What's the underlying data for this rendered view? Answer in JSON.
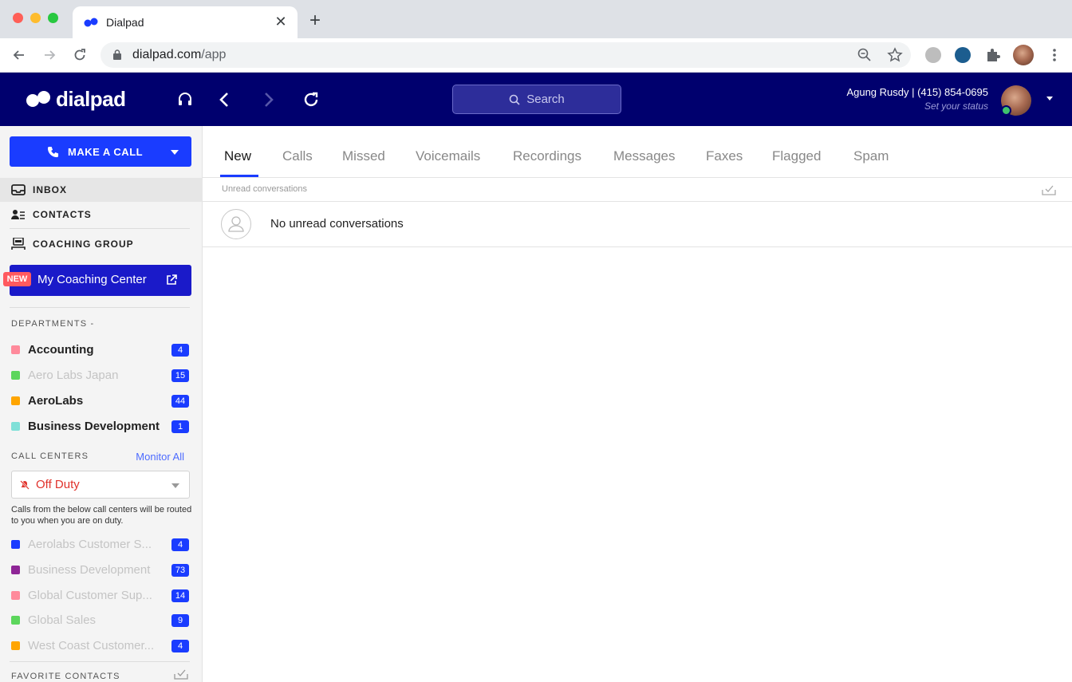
{
  "browser": {
    "tab_title": "Dialpad",
    "tab_close": "✕",
    "new_tab": "+",
    "url_host": "dialpad.com",
    "url_path": "/app"
  },
  "app": {
    "logo_text": "dialpad",
    "search_placeholder": "Search",
    "user_name": "Agung Rusdy | (415) 854-0695",
    "user_status": "Set your status"
  },
  "sidebar": {
    "make_call": "MAKE A CALL",
    "nav": [
      {
        "label": "INBOX",
        "icon": "inbox-icon"
      },
      {
        "label": "CONTACTS",
        "icon": "contacts-icon"
      },
      {
        "label": "COACHING GROUP",
        "icon": "coaching-group-icon"
      }
    ],
    "coaching_badge": "NEW",
    "coaching_center": "My Coaching Center",
    "departments_title": "DEPARTMENTS  -",
    "departments": [
      {
        "name": "Accounting",
        "count": "4",
        "color": "#ff8a9b",
        "dim": false
      },
      {
        "name": "Aero Labs Japan",
        "count": "15",
        "color": "#5cd65c",
        "dim": true
      },
      {
        "name": "AeroLabs",
        "count": "44",
        "color": "#ffa500",
        "dim": false
      },
      {
        "name": "Business Development",
        "count": "1",
        "color": "#7fe0d8",
        "dim": false
      }
    ],
    "call_centers_title": "CALL CENTERS",
    "monitor_all": "Monitor All",
    "duty_status": "Off Duty",
    "duty_note": "Calls from the below call centers will be routed to you when you are on duty.",
    "call_centers": [
      {
        "name": "Aerolabs Customer S...",
        "count": "4",
        "color": "#1a3cff"
      },
      {
        "name": "Business Development",
        "count": "73",
        "color": "#8e2596"
      },
      {
        "name": "Global Customer Sup...",
        "count": "14",
        "color": "#ff8a9b"
      },
      {
        "name": "Global Sales",
        "count": "9",
        "color": "#5cd65c"
      },
      {
        "name": "West Coast Customer...",
        "count": "4",
        "color": "#ffa500"
      }
    ],
    "favorites_title": "FAVORITE CONTACTS"
  },
  "main": {
    "tabs": [
      "New",
      "Calls",
      "Missed",
      "Voicemails",
      "Recordings",
      "Messages",
      "Faxes",
      "Flagged",
      "Spam"
    ],
    "subheader": "Unread conversations",
    "empty_text": "No unread conversations"
  }
}
